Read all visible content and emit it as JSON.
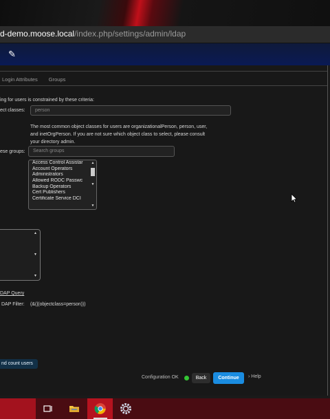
{
  "browser": {
    "url_host": "d-demo.moose.local",
    "url_path": "/index.php/settings/admin/ldap"
  },
  "tabs": [
    "Login Attributes",
    "Groups"
  ],
  "criteria_text": "ing for users is constrained by these criteria:",
  "object_classes": {
    "label": "ect classes:",
    "value": "person"
  },
  "hint_text": "The most common object classes for users are organizationalPerson, person, user, and inetOrgPerson. If you are not sure which object class to select, please consult your directory admin.",
  "groups": {
    "label": "ese groups:",
    "search_placeholder": "Search groups",
    "items": [
      "Access Control Assistar",
      "Account Operators",
      "Administrators",
      "Allowed RODC Passwc",
      "Backup Operators",
      "Cert Publishers",
      "Certificate Service DCI"
    ]
  },
  "ldap_query_link": "DAP Query",
  "ldap_filter": {
    "label": "DAP Filter:",
    "value": "(&(|(objectclass=person)))"
  },
  "count_users_button": "nd count users",
  "footer": {
    "config_status": "Configuration OK",
    "status_color": "#34c534",
    "back_label": "Back",
    "continue_label": "Continue",
    "help_label": "Help"
  },
  "taskbar": {
    "icons": [
      "task-view-icon",
      "file-explorer-icon",
      "chrome-icon",
      "settings-icon"
    ]
  }
}
